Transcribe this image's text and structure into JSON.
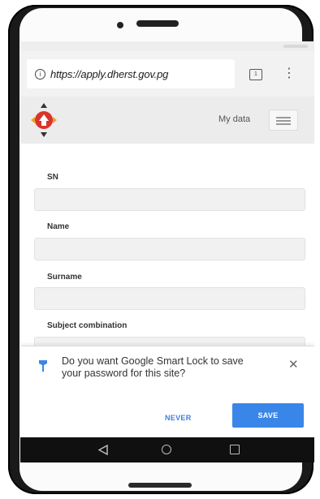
{
  "browser": {
    "url": "https://apply.dherst.gov.pg",
    "tab_count": "1"
  },
  "site": {
    "nav_link": "My data"
  },
  "form": {
    "fields": [
      {
        "label": "SN",
        "value": ""
      },
      {
        "label": "Name",
        "value": ""
      },
      {
        "label": "Surname",
        "value": ""
      }
    ],
    "next_label": "Subject combination"
  },
  "smart_lock": {
    "message": "Do you want Google Smart Lock to save your password for this site?",
    "never_label": "NEVER",
    "save_label": "SAVE"
  },
  "colors": {
    "accent": "#3a86e8",
    "logo_red": "#d9342b",
    "logo_orange": "#f0a020"
  }
}
